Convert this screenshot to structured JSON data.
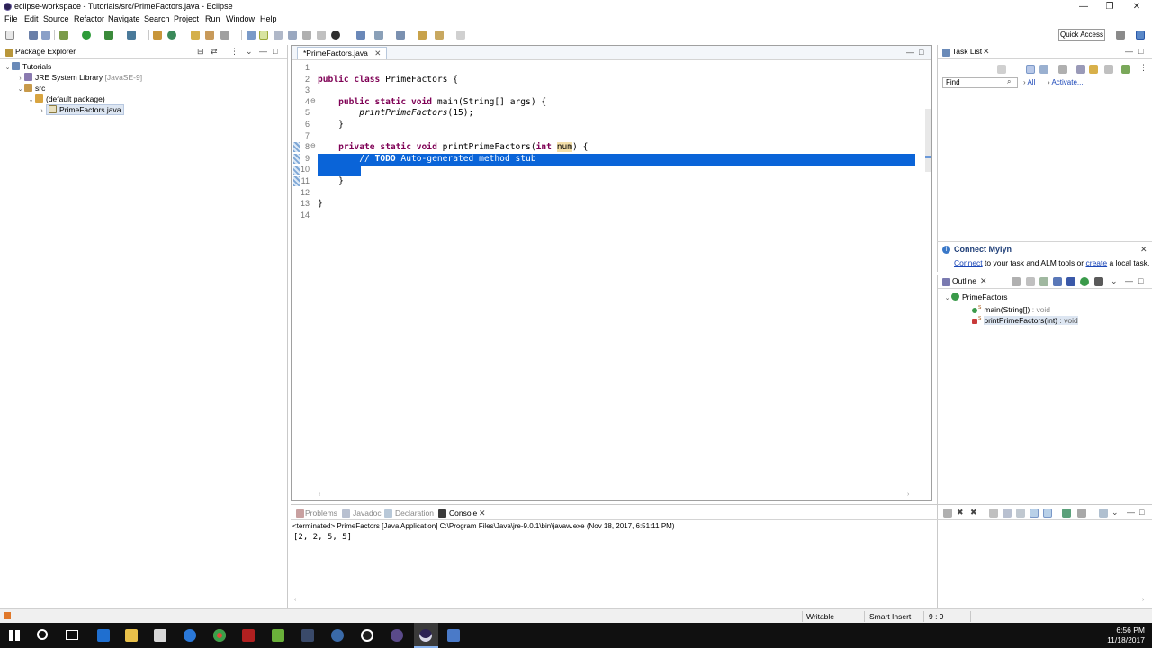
{
  "window": {
    "title": "eclipse-workspace - Tutorials/src/PrimeFactors.java - Eclipse",
    "minimize": "—",
    "maximize": "❐",
    "close": "✕"
  },
  "menu": [
    "File",
    "Edit",
    "Source",
    "Refactor",
    "Navigate",
    "Search",
    "Project",
    "Run",
    "Window",
    "Help"
  ],
  "toolbar": {
    "quick_access": "Quick Access"
  },
  "package_explorer": {
    "title": "Package Explorer",
    "tree": [
      {
        "label": "Tutorials",
        "depth": 0,
        "arrow": "⌄",
        "icon": "project-icon"
      },
      {
        "label": "JRE System Library",
        "suffix": "[JavaSE-9]",
        "depth": 1,
        "arrow": "›",
        "icon": "library-icon"
      },
      {
        "label": "src",
        "depth": 1,
        "arrow": "⌄",
        "icon": "source-folder-icon"
      },
      {
        "label": "(default package)",
        "depth": 2,
        "arrow": "⌄",
        "icon": "package-icon"
      },
      {
        "label": "PrimeFactors.java",
        "depth": 3,
        "arrow": "›",
        "icon": "java-file-icon"
      }
    ]
  },
  "editor": {
    "tab_label": "*PrimeFactors.java",
    "lines": [
      "1",
      "2",
      "3",
      "4",
      "5",
      "6",
      "7",
      "8",
      "9",
      "10",
      "11",
      "12",
      "13",
      "14"
    ],
    "fold_markers": {
      "4": "⊖",
      "8": "⊖"
    },
    "code": {
      "l2_kw": "public class",
      "l2_rest": " PrimeFactors {",
      "l4_kw": "public static void",
      "l4_rest": " main(String[] args) {",
      "l5_call": "printPrimeFactors",
      "l5_rest": "(15);",
      "l6": "}",
      "l8_kw": "private static void",
      "l8_mid": " printPrimeFactors(",
      "l8_kw2": "int",
      "l8_param": "num",
      "l8_end": ") {",
      "l9_pre": "// ",
      "l9_todo": "TODO",
      "l9_rest": " Auto-generated method stub",
      "l11": "}",
      "l13": "}"
    }
  },
  "task_list": {
    "title": "Task List",
    "find_placeholder": "Find",
    "all_label": "All",
    "activate_label": "Activate..."
  },
  "mylyn": {
    "title": "Connect Mylyn",
    "connect": "Connect",
    "text1": " to your task and ALM tools or ",
    "create": "create",
    "text2": " a local task."
  },
  "outline": {
    "title": "Outline",
    "class_name": "PrimeFactors",
    "members": [
      {
        "name": "main(String[])",
        "type": " : void"
      },
      {
        "name": "printPrimeFactors(int)",
        "type": " : void"
      }
    ],
    "member_marker": "S"
  },
  "console": {
    "tabs": [
      "Problems",
      "Javadoc",
      "Declaration",
      "Console"
    ],
    "header": "<terminated> PrimeFactors [Java Application] C:\\Program Files\\Java\\jre-9.0.1\\bin\\javaw.exe (Nov 18, 2017, 6:51:11 PM)",
    "output": "[2, 2, 5, 5]"
  },
  "status": {
    "mode": "Writable",
    "insert": "Smart Insert",
    "position": "9 : 9"
  },
  "taskbar": {
    "time": "6:56 PM",
    "date": "11/18/2017"
  },
  "colors": {
    "selection": "#0a64d8",
    "keyword": "#7f0055",
    "link": "#1a46b8"
  }
}
